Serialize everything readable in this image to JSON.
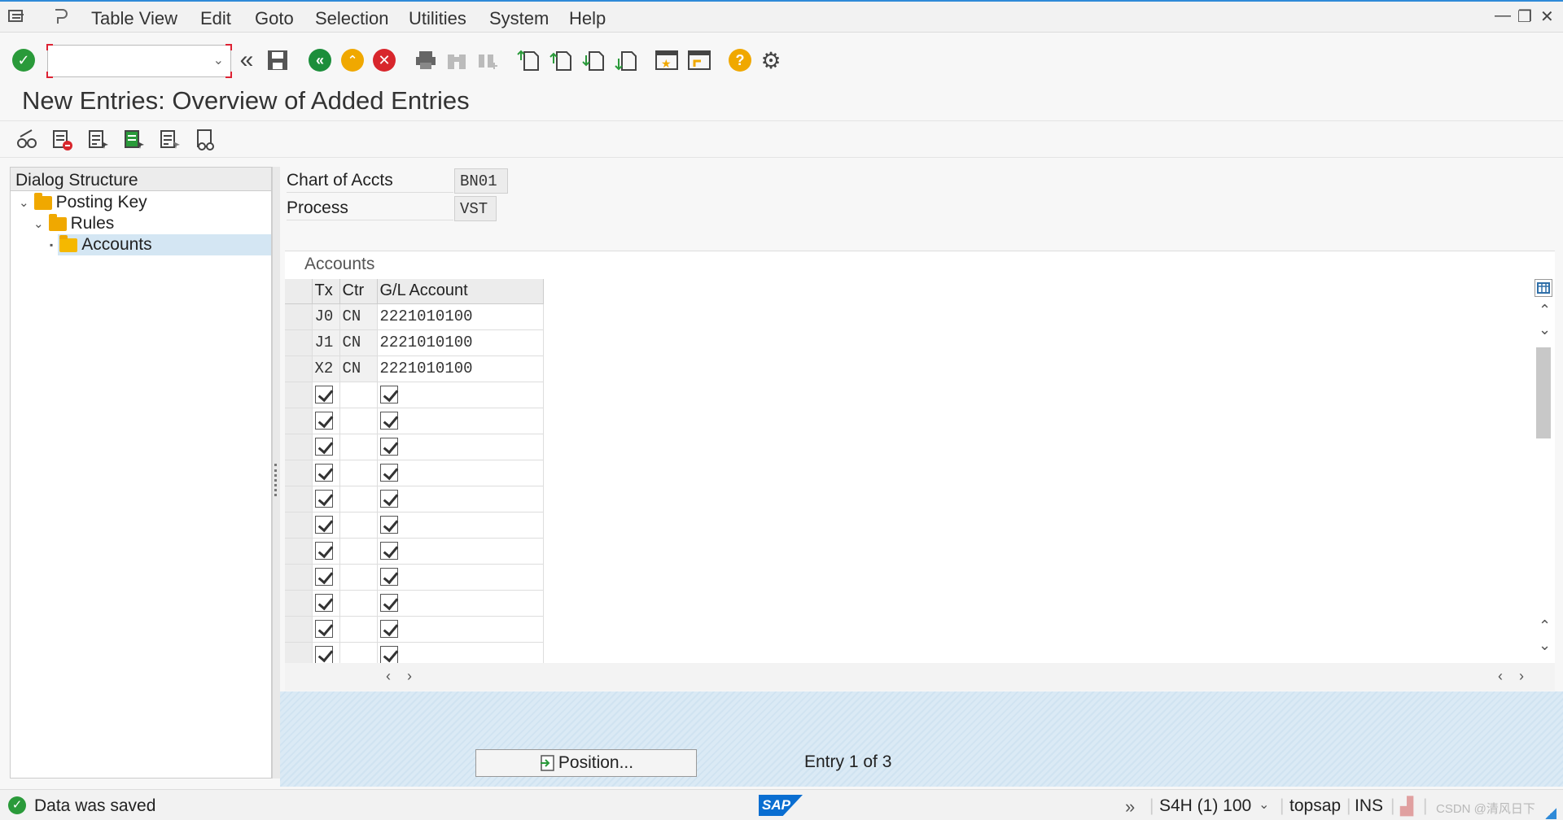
{
  "menu": {
    "items": [
      "Table View",
      "Edit",
      "Goto",
      "Selection",
      "Utilities",
      "System",
      "Help"
    ]
  },
  "toolbar": {
    "command_field_value": ""
  },
  "page": {
    "title": "New Entries: Overview of Added Entries"
  },
  "tree": {
    "header": "Dialog Structure",
    "nodes": [
      {
        "label": "Posting Key",
        "expanded": true
      },
      {
        "label": "Rules",
        "expanded": true
      },
      {
        "label": "Accounts",
        "selected": true
      }
    ]
  },
  "header_fields": [
    {
      "label": "Chart of Accts",
      "value": "BN01"
    },
    {
      "label": "Process",
      "value": "VST"
    }
  ],
  "accounts": {
    "title": "Accounts",
    "columns": [
      "Tx",
      "Ctr",
      "G/L Account"
    ],
    "rows": [
      {
        "tx": "J0",
        "ctr": "CN",
        "gl": "2221010100"
      },
      {
        "tx": "J1",
        "ctr": "CN",
        "gl": "2221010100"
      },
      {
        "tx": "X2",
        "ctr": "CN",
        "gl": "2221010100"
      }
    ],
    "empty_rows": 11
  },
  "bottom": {
    "position_button": "Position...",
    "entry_text": "Entry 1 of 3"
  },
  "status": {
    "message": "Data was saved",
    "system": "S4H (1) 100",
    "server": "topsap",
    "mode": "INS",
    "watermark": "CSDN @清风日下"
  },
  "colors": {
    "accent": "#2f8ad8",
    "ok_green": "#2a9a3a",
    "cancel_red": "#d8262c",
    "exit_orange": "#f0a800",
    "back_green": "#1c8e3b",
    "tree_selection": "#d4e6f3"
  }
}
